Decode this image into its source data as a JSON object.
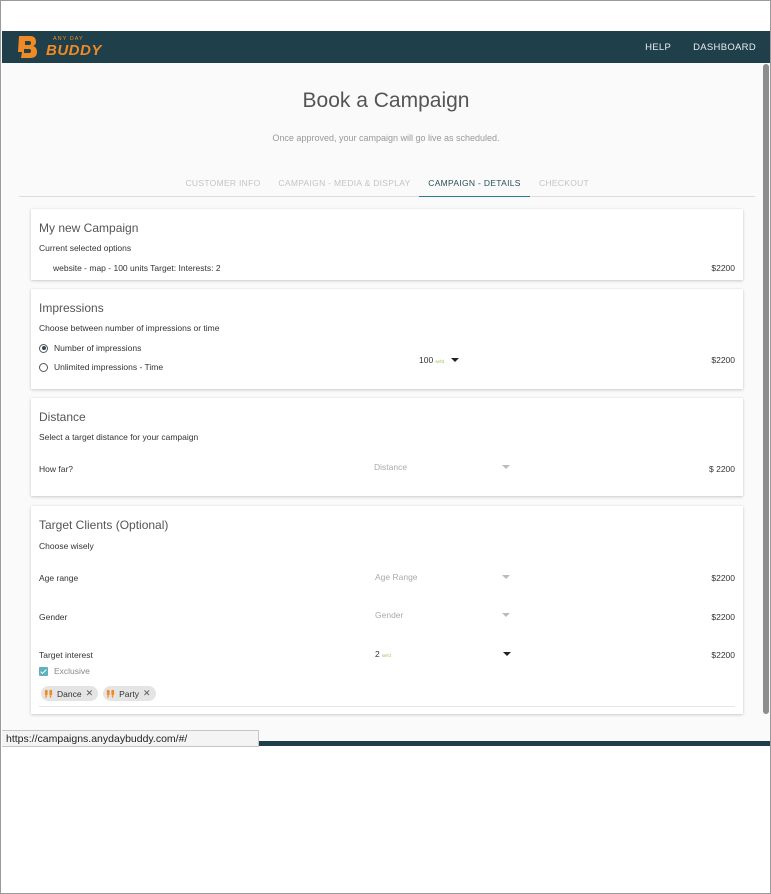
{
  "header": {
    "logo_top": "ANY DAY",
    "logo_main": "BUDDY",
    "nav": [
      "HELP",
      "DASHBOARD"
    ]
  },
  "page": {
    "title": "Book a Campaign",
    "subtitle": "Once approved, your campaign will go live as scheduled."
  },
  "tabs": [
    {
      "label": "CUSTOMER INFO",
      "active": false
    },
    {
      "label": "CAMPAIGN - MEDIA & DISPLAY",
      "active": false
    },
    {
      "label": "CAMPAIGN - DETAILS",
      "active": true
    },
    {
      "label": "CHECKOUT",
      "active": false
    }
  ],
  "campaign": {
    "title": "My new Campaign",
    "subtitle": "Current selected options",
    "summary": "website - map - 100 units Target: Interests: 2",
    "price": "$2200"
  },
  "impressions": {
    "title": "Impressions",
    "subtitle": "Choose between number of impressions or time",
    "option_number": "Number of impressions",
    "option_time": "Unlimited impressions - Time",
    "selected_value": "100",
    "selected_tag": "sel'd",
    "price": "$2200"
  },
  "distance": {
    "title": "Distance",
    "subtitle": "Select a target distance for your campaign",
    "label": "How far?",
    "placeholder": "Distance",
    "price": "$ 2200"
  },
  "target": {
    "title": "Target Clients (Optional)",
    "subtitle": "Choose wisely",
    "age_label": "Age range",
    "age_placeholder": "Age Range",
    "age_price": "$2200",
    "gender_label": "Gender",
    "gender_placeholder": "Gender",
    "gender_price": "$2200",
    "interest_label": "Target interest",
    "interest_value": "2",
    "interest_tag": "sel'd",
    "interest_price": "$2200",
    "exclusive_label": "Exclusive",
    "chips": [
      "Dance",
      "Party"
    ]
  },
  "status_bar": {
    "url": "https://campaigns.anydaybuddy.com/#/"
  },
  "colors": {
    "navbar": "#1f3f4a",
    "accent": "#2a7b8c",
    "logo_orange": "#f08a24"
  }
}
